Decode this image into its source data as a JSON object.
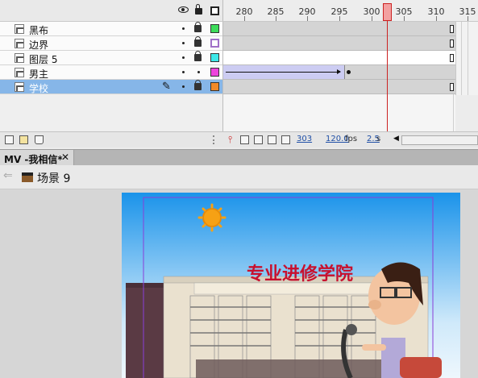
{
  "timeline": {
    "ruler_labels": [
      "280",
      "285",
      "290",
      "295",
      "300",
      "305",
      "310",
      "315"
    ],
    "layers": [
      {
        "name": "黑布",
        "color": "#3ddc5a",
        "selected": false
      },
      {
        "name": "边界",
        "color": "#c9a0e6",
        "selected": false
      },
      {
        "name": "图层 5",
        "color": "#3ee8e8",
        "selected": false
      },
      {
        "name": "男主",
        "color": "#ee44dd",
        "selected": false
      },
      {
        "name": "学校",
        "color": "#f08a2a",
        "selected": true
      }
    ],
    "current_frame": "303",
    "frame_rate": "120.0",
    "frame_rate_unit": "fps",
    "elapsed_time": "2.5",
    "elapsed_unit": "s"
  },
  "tab": {
    "label": "MV -我相信*",
    "close_glyph": "✕"
  },
  "scene": {
    "back_glyph": "⇐",
    "label": "场景 9"
  },
  "stage": {
    "school_name": "专业进修学院"
  },
  "colors": {
    "accent": "#86b6e8",
    "playhead": "#cc2222",
    "title_red": "#c8102e"
  }
}
